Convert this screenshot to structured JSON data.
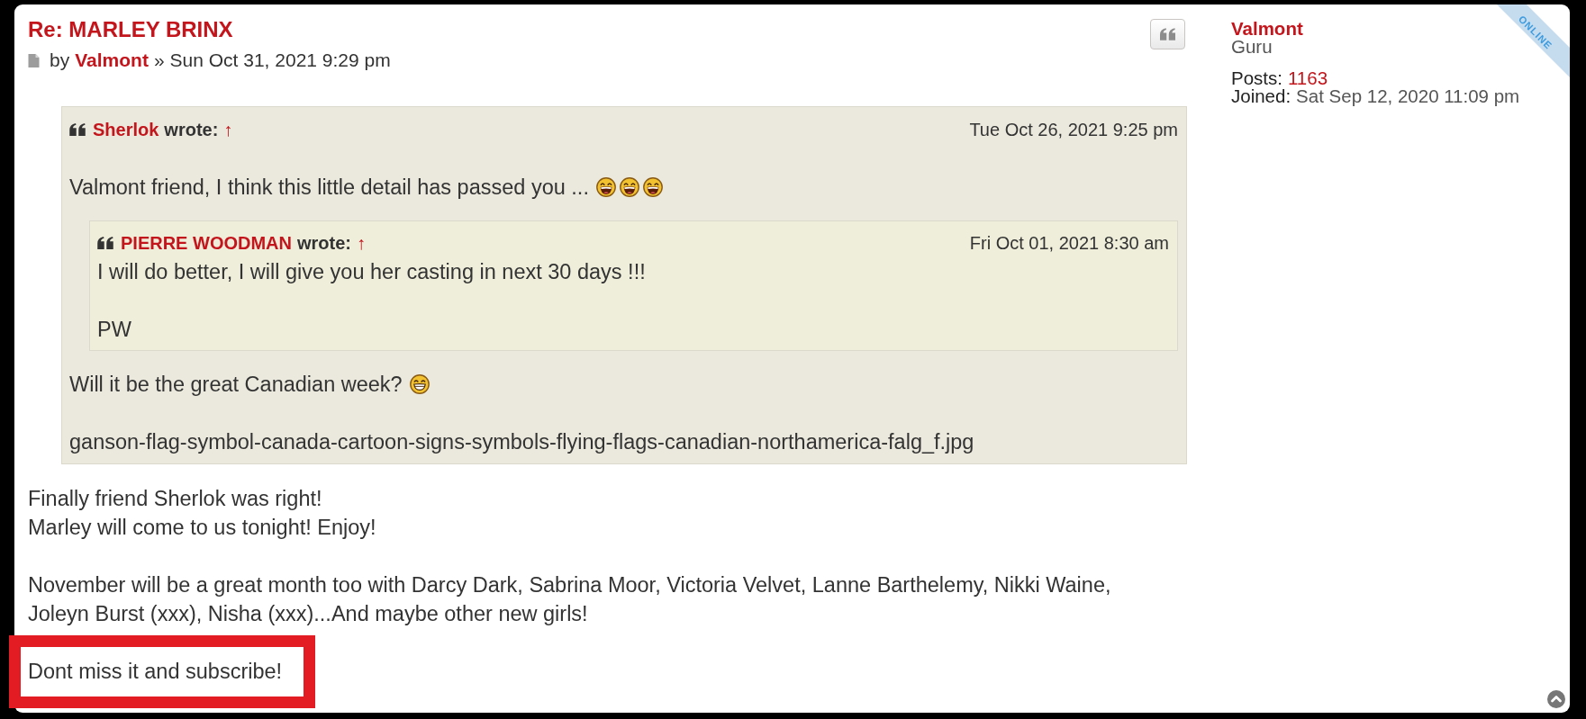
{
  "post": {
    "title": "Re: MARLEY BRINX",
    "byline": {
      "prefix": "by",
      "author": "Valmont",
      "separator": "»",
      "date": "Sun Oct 31, 2021 9:29 pm"
    },
    "body": [
      {
        "kind": "quote",
        "highlighted": false,
        "author": "Sherlok",
        "cite_label": "wrote:",
        "jump_link": "↑",
        "date": "Tue Oct 26, 2021 9:25 pm",
        "content": [
          {
            "kind": "text",
            "lines": [
              "Valmont friend, I think this little detail has passed you ..."
            ],
            "smilies": [
              {
                "kind": "laughing"
              },
              {
                "kind": "laughing"
              },
              {
                "kind": "laughing"
              }
            ]
          },
          {
            "kind": "quote",
            "author": "PIERRE WOODMAN",
            "cite_label": "wrote:",
            "jump_link": "↑",
            "date": "Fri Oct 01, 2021 8:30 am",
            "content": [
              {
                "kind": "text",
                "lines": [
                  "I will do better, I will give you her casting in next 30 days !!!"
                ]
              },
              {
                "kind": "text",
                "lines": [
                  "PW"
                ]
              }
            ]
          },
          {
            "kind": "text",
            "lines": [
              "Will it be the great Canadian week?"
            ],
            "smilies": [
              {
                "kind": "grinning"
              }
            ]
          },
          {
            "kind": "text",
            "lines": [
              "ganson-flag-symbol-canada-cartoon-signs-symbols-flying-flags-canadian-northamerica-falg_f.jpg"
            ]
          }
        ]
      },
      {
        "kind": "text",
        "highlighted": false,
        "lines": [
          "Finally friend Sherlok was right!",
          "Marley will come to us tonight! Enjoy!"
        ]
      },
      {
        "kind": "text",
        "highlighted": false,
        "lines": [
          "November will be a great month too with Darcy Dark, Sabrina Moor, Victoria Velvet, Lanne Barthelemy, Nikki Waine,",
          "Joleyn Burst (xxx), Nisha (xxx)...And maybe other new girls!"
        ]
      },
      {
        "kind": "text",
        "highlighted": true,
        "lines": [
          "Dont miss it and subscribe!"
        ]
      }
    ]
  },
  "profile": {
    "username": "Valmont",
    "rank": "Guru",
    "details": [
      {
        "label": "Posts:",
        "value": "1163",
        "kind": "link"
      },
      {
        "label": "Joined:",
        "value": "Sat Sep 12, 2020 11:09 pm",
        "kind": "plain"
      }
    ],
    "status": {
      "online": true,
      "label": "ONLINE"
    }
  }
}
